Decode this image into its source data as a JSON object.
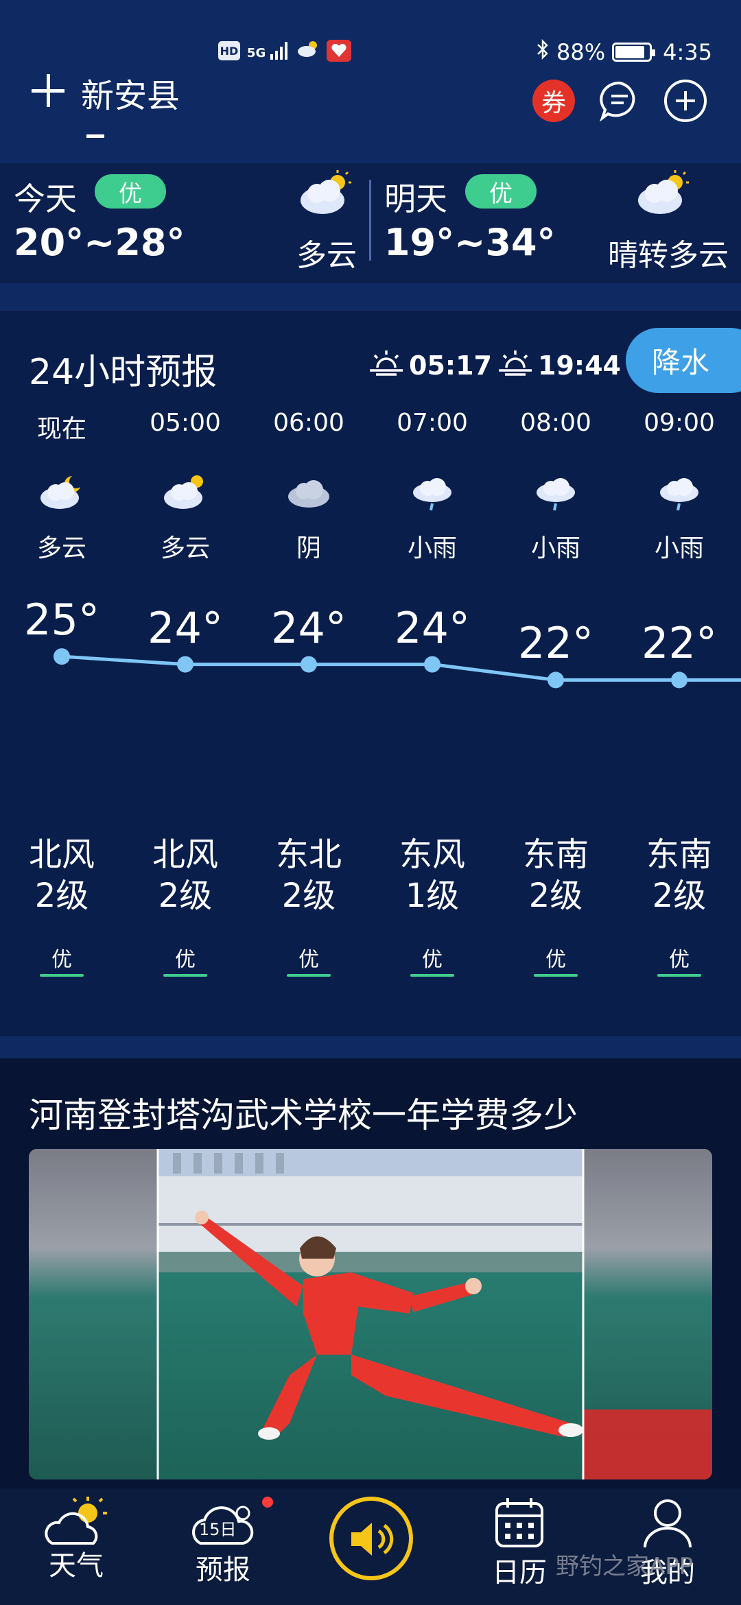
{
  "status_bar": {
    "hd": "HD",
    "signal": "5G",
    "battery_percent": "88%",
    "battery_level": 0.88,
    "time": "4:35"
  },
  "header": {
    "city": "新安县",
    "coupon_label": "券"
  },
  "days": [
    {
      "label": "今天",
      "aqi": "优",
      "temp": "20°~28°",
      "condition": "多云"
    },
    {
      "label": "明天",
      "aqi": "优",
      "temp": "19°~34°",
      "condition": "晴转多云"
    }
  ],
  "hourly": {
    "title": "24小时预报",
    "sunrise": "05:17",
    "sunset": "19:44",
    "rain_button": "降水",
    "items": [
      {
        "time": "现在",
        "weather": "多云",
        "icon": "partly-cloudy-night-icon",
        "temp": "25°",
        "temp_value": 25,
        "wind_dir": "北风",
        "wind_level": "2级",
        "aqi": "优"
      },
      {
        "time": "05:00",
        "weather": "多云",
        "icon": "partly-cloudy-day-icon",
        "temp": "24°",
        "temp_value": 24,
        "wind_dir": "北风",
        "wind_level": "2级",
        "aqi": "优"
      },
      {
        "time": "06:00",
        "weather": "阴",
        "icon": "overcast-icon",
        "temp": "24°",
        "temp_value": 24,
        "wind_dir": "东北",
        "wind_level": "2级",
        "aqi": "优"
      },
      {
        "time": "07:00",
        "weather": "小雨",
        "icon": "light-rain-icon",
        "temp": "24°",
        "temp_value": 24,
        "wind_dir": "东风",
        "wind_level": "1级",
        "aqi": "优"
      },
      {
        "time": "08:00",
        "weather": "小雨",
        "icon": "light-rain-icon",
        "temp": "22°",
        "temp_value": 22,
        "wind_dir": "东南",
        "wind_level": "2级",
        "aqi": "优"
      },
      {
        "time": "09:00",
        "weather": "小雨",
        "icon": "light-rain-icon",
        "temp": "22°",
        "temp_value": 22,
        "wind_dir": "东南",
        "wind_level": "2级",
        "aqi": "优"
      }
    ]
  },
  "news": {
    "title": "河南登封塔沟武术学校一年学费多少"
  },
  "bottom_nav": [
    {
      "label": "天气",
      "icon": "weather-icon"
    },
    {
      "label": "预报",
      "icon": "forecast-15day-icon",
      "badge_text": "15日"
    },
    {
      "label": "",
      "icon": "speaker-icon"
    },
    {
      "label": "日历",
      "icon": "calendar-icon"
    },
    {
      "label": "我的",
      "icon": "profile-icon"
    }
  ],
  "watermark": "野钓之家APP",
  "colors": {
    "background": "#0b1f4d",
    "aqi_good": "#3fcc8f",
    "rain_button": "#3ea0e6",
    "temp_line": "#7fc6f5",
    "coupon": "#e53229",
    "speaker_ring": "#f5c518"
  }
}
